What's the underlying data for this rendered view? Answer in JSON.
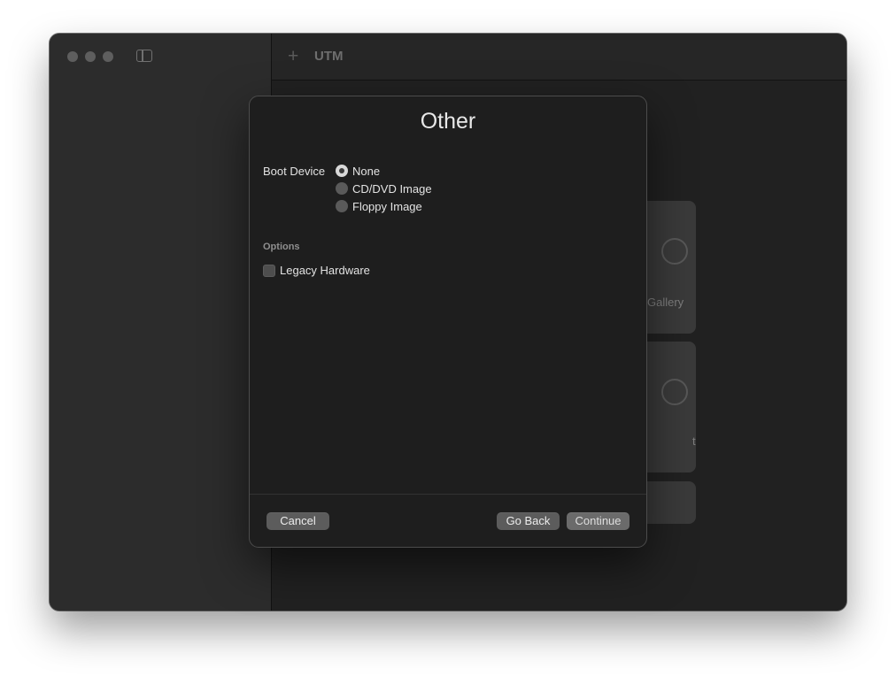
{
  "window": {
    "title": "UTM"
  },
  "background_cards": [
    {
      "label": "Gallery"
    },
    {
      "label": "t"
    },
    {
      "label": ""
    }
  ],
  "dialog": {
    "title": "Other",
    "boot_device": {
      "label": "Boot Device",
      "options": [
        {
          "label": "None",
          "selected": true
        },
        {
          "label": "CD/DVD Image",
          "selected": false
        },
        {
          "label": "Floppy Image",
          "selected": false
        }
      ]
    },
    "options_section": {
      "header": "Options",
      "legacy_hardware": {
        "label": "Legacy Hardware",
        "checked": false
      }
    },
    "buttons": {
      "cancel": "Cancel",
      "go_back": "Go Back",
      "continue": "Continue"
    }
  }
}
